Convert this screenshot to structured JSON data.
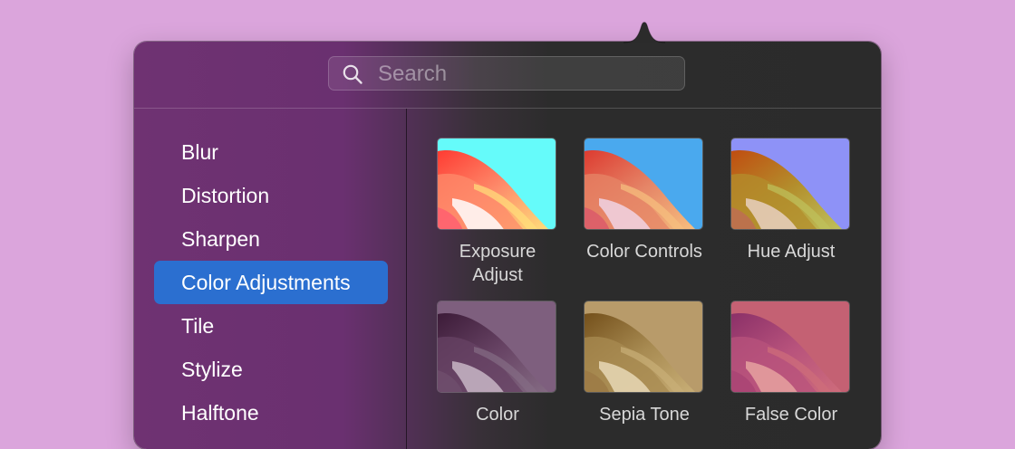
{
  "search": {
    "placeholder": "Search",
    "value": ""
  },
  "categories": [
    {
      "label": "Blur",
      "selected": false
    },
    {
      "label": "Distortion",
      "selected": false
    },
    {
      "label": "Sharpen",
      "selected": false
    },
    {
      "label": "Color Adjustments",
      "selected": true
    },
    {
      "label": "Tile",
      "selected": false
    },
    {
      "label": "Stylize",
      "selected": false
    },
    {
      "label": "Halftone",
      "selected": false
    }
  ],
  "filters": [
    {
      "label": "Exposure Adjust",
      "colors": [
        "#65fbfa",
        "#ff3b32",
        "#fd8b6b",
        "#ffe07a",
        "#fffefe",
        "#ff5f70"
      ]
    },
    {
      "label": "Color Controls",
      "colors": [
        "#4aa9ee",
        "#dd3b30",
        "#e58567",
        "#f7c07f",
        "#f0d4e4",
        "#db5b6a"
      ]
    },
    {
      "label": "Hue Adjust",
      "colors": [
        "#8e92f7",
        "#c04d10",
        "#b38e2c",
        "#bfc25d",
        "#e7d0c1",
        "#bd6d52"
      ]
    },
    {
      "label": "Color",
      "colors": [
        "#7e5f7e",
        "#3c1b38",
        "#674364",
        "#856c84",
        "#c8b6c6",
        "#6f4d6c"
      ]
    },
    {
      "label": "Sepia Tone",
      "colors": [
        "#b89b6a",
        "#74501b",
        "#a88b52",
        "#c9af77",
        "#e8d8b6",
        "#9c7a45"
      ]
    },
    {
      "label": "False Color",
      "colors": [
        "#c46173",
        "#8b3068",
        "#b8537c",
        "#cf6d7b",
        "#e6a2a0",
        "#a94474"
      ]
    }
  ],
  "colors": {
    "background": "#dba5dc",
    "selection": "#2b6fd0"
  }
}
